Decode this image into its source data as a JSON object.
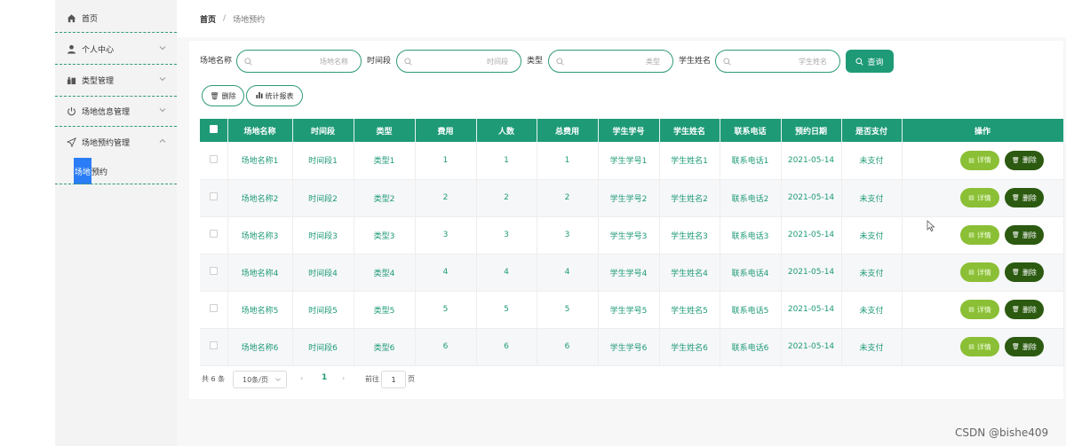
{
  "sidebar": {
    "items": [
      {
        "label": "首页",
        "icon": "home-icon",
        "expandable": false
      },
      {
        "label": "个人中心",
        "icon": "user-icon",
        "expandable": true
      },
      {
        "label": "类型管理",
        "icon": "category-icon",
        "expandable": true
      },
      {
        "label": "场地信息管理",
        "icon": "power-icon",
        "expandable": true
      },
      {
        "label": "场地预约管理",
        "icon": "send-icon",
        "expandable": true,
        "expanded": true
      }
    ],
    "sub_item": {
      "label_highlight": "场地",
      "label_rest": "预约"
    }
  },
  "breadcrumb": {
    "home": "首页",
    "separator": "/",
    "current": "场地预约"
  },
  "search": {
    "fields": [
      {
        "label": "场地名称",
        "placeholder": "场地名称"
      },
      {
        "label": "时间段",
        "placeholder": "时间段"
      },
      {
        "label": "类型",
        "placeholder": "类型"
      },
      {
        "label": "学生姓名",
        "placeholder": "学生姓名"
      }
    ],
    "query_label": "查询"
  },
  "actions": {
    "delete_label": "删除",
    "report_label": "统计报表"
  },
  "table": {
    "columns": [
      "场地名称",
      "时间段",
      "类型",
      "费用",
      "人数",
      "总费用",
      "学生学号",
      "学生姓名",
      "联系电话",
      "预约日期",
      "是否支付",
      "操作"
    ],
    "rows": [
      [
        "场地名称1",
        "时间段1",
        "类型1",
        "1",
        "1",
        "1",
        "学生学号1",
        "学生姓名1",
        "联系电话1",
        "2021-05-14",
        "未支付"
      ],
      [
        "场地名称2",
        "时间段2",
        "类型2",
        "2",
        "2",
        "2",
        "学生学号2",
        "学生姓名2",
        "联系电话2",
        "2021-05-14",
        "未支付"
      ],
      [
        "场地名称3",
        "时间段3",
        "类型3",
        "3",
        "3",
        "3",
        "学生学号3",
        "学生姓名3",
        "联系电话3",
        "2021-05-14",
        "未支付"
      ],
      [
        "场地名称4",
        "时间段4",
        "类型4",
        "4",
        "4",
        "4",
        "学生学号4",
        "学生姓名4",
        "联系电话4",
        "2021-05-14",
        "未支付"
      ],
      [
        "场地名称5",
        "时间段5",
        "类型5",
        "5",
        "5",
        "5",
        "学生学号5",
        "学生姓名5",
        "联系电话5",
        "2021-05-14",
        "未支付"
      ],
      [
        "场地名称6",
        "时间段6",
        "类型6",
        "6",
        "6",
        "6",
        "学生学号6",
        "学生姓名6",
        "联系电话6",
        "2021-05-14",
        "未支付"
      ]
    ],
    "detail_label": "详情",
    "delete_label": "删除"
  },
  "pagination": {
    "total": "共 6 条",
    "page_size": "10条/页",
    "current_page": "1",
    "goto_label": "前往",
    "goto_value": "1",
    "page_suffix": "页"
  },
  "watermark": "CSDN @bishe409",
  "colors": {
    "accent": "#1e9a77",
    "detail_button": "#8bbf35",
    "delete_button": "#2b5a10",
    "highlight": "#2b7df5"
  }
}
